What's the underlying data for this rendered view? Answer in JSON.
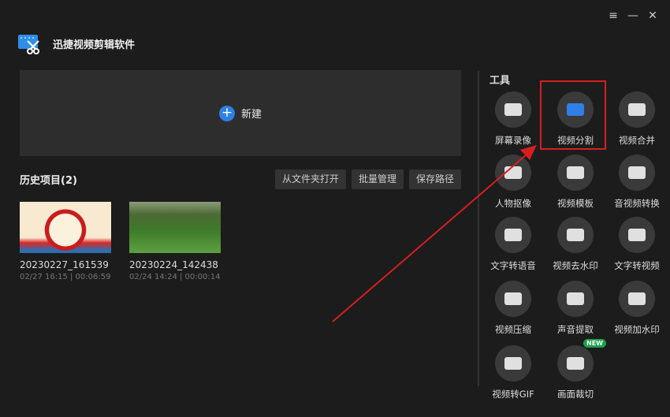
{
  "app": {
    "title": "迅捷视频剪辑软件"
  },
  "window": {
    "menu": "≡",
    "minimize": "—",
    "close": "✕"
  },
  "new_project": {
    "label": "新建",
    "icon": "plus-icon"
  },
  "history": {
    "heading": "历史项目(2)",
    "buttons": [
      "从文件夹打开",
      "批量管理",
      "保存路径"
    ],
    "projects": [
      {
        "name": "20230227_161539",
        "meta": "02/27 16:15 | 00:06:59"
      },
      {
        "name": "20230224_142438",
        "meta": "02/24 14:24 | 00:00:14"
      }
    ]
  },
  "tools": {
    "heading": "工具",
    "items": [
      {
        "label": "屏幕录像"
      },
      {
        "label": "视频分割"
      },
      {
        "label": "视频合并"
      },
      {
        "label": "人物抠像"
      },
      {
        "label": "视频模板"
      },
      {
        "label": "音视频转换"
      },
      {
        "label": "文字转语音"
      },
      {
        "label": "视频去水印"
      },
      {
        "label": "文字转视频"
      },
      {
        "label": "视频压缩"
      },
      {
        "label": "声音提取"
      },
      {
        "label": "视频加水印"
      },
      {
        "label": "视频转GIF"
      },
      {
        "label": "画面裁切",
        "badge": "NEW"
      }
    ]
  },
  "colors": {
    "accent": "#2f7fe6",
    "highlight": "#d61f1f"
  }
}
